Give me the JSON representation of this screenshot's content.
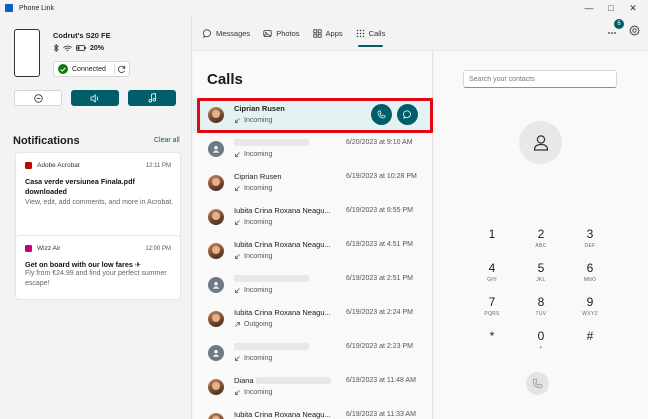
{
  "window": {
    "title": "Phone Link"
  },
  "device": {
    "name": "Codrut's S20 FE",
    "battery": "20%",
    "status": "Connected"
  },
  "notifications": {
    "heading": "Notifications",
    "clear_all": "Clear all",
    "items": [
      {
        "app": "Adobe Acrobat",
        "time": "12:11 PM",
        "title": "Casa verde versiunea Finala.pdf downloaded",
        "body": "View, edit, add comments, and more in Acrobat.",
        "app_color": "#b30b00"
      },
      {
        "app": "Wizz Air",
        "time": "12:00 PM",
        "title": "Get on board with our low fares ✈",
        "body": "Fly from €24.99 and find your perfect summer escape!",
        "app_color": "#c6007e"
      }
    ]
  },
  "nav": {
    "tabs": [
      {
        "label": "Messages",
        "icon": "message-icon"
      },
      {
        "label": "Photos",
        "icon": "photos-icon"
      },
      {
        "label": "Apps",
        "icon": "apps-icon"
      },
      {
        "label": "Calls",
        "icon": "dialpad-icon"
      }
    ],
    "active": "Calls",
    "notification_badge": "6"
  },
  "calls": {
    "title": "Calls",
    "items": [
      {
        "name": "Ciprian Rusen",
        "type": "Incoming",
        "time": "",
        "avatar": "photo",
        "selected": true
      },
      {
        "name": "",
        "type": "Incoming",
        "time": "6/20/2023 at 9:10 AM",
        "avatar": "generic"
      },
      {
        "name": "Ciprian Rusen",
        "type": "Incoming",
        "time": "6/19/2023 at 10:28 PM",
        "avatar": "photo"
      },
      {
        "name": "Iubita Crina Roxana Neagu...",
        "type": "Incoming",
        "time": "6/19/2023 at 6:55 PM",
        "avatar": "photo"
      },
      {
        "name": "Iubita Crina Roxana Neagu...",
        "type": "Incoming",
        "time": "6/19/2023 at 4:51 PM",
        "avatar": "photo"
      },
      {
        "name": "",
        "type": "Incoming",
        "time": "6/19/2023 at 2:51 PM",
        "avatar": "generic"
      },
      {
        "name": "Iubita Crina Roxana Neagu...",
        "type": "Outgoing",
        "time": "6/19/2023 at 2:24 PM",
        "avatar": "photo"
      },
      {
        "name": "",
        "type": "Incoming",
        "time": "6/19/2023 at 2:23 PM",
        "avatar": "generic"
      },
      {
        "name": "Diana",
        "type": "Incoming",
        "time": "6/19/2023 at 11:48 AM",
        "avatar": "photo"
      },
      {
        "name": "Iubita Crina Roxana Neagu...",
        "type": "",
        "time": "6/19/2023 at 11:33 AM",
        "avatar": "photo"
      }
    ]
  },
  "dialer": {
    "search_placeholder": "Search your contacts",
    "keys": [
      {
        "digit": "1",
        "letters": ""
      },
      {
        "digit": "2",
        "letters": "ABC"
      },
      {
        "digit": "3",
        "letters": "DEF"
      },
      {
        "digit": "4",
        "letters": "GHI"
      },
      {
        "digit": "5",
        "letters": "JKL"
      },
      {
        "digit": "6",
        "letters": "MNO"
      },
      {
        "digit": "7",
        "letters": "PQRS"
      },
      {
        "digit": "8",
        "letters": "TUV"
      },
      {
        "digit": "9",
        "letters": "WXYZ"
      },
      {
        "digit": "*",
        "letters": ""
      },
      {
        "digit": "0",
        "letters": "+"
      },
      {
        "digit": "#",
        "letters": ""
      }
    ]
  },
  "colors": {
    "accent": "#005e6a",
    "selected_row": "#e4f2f3",
    "highlight": "#e30613"
  }
}
